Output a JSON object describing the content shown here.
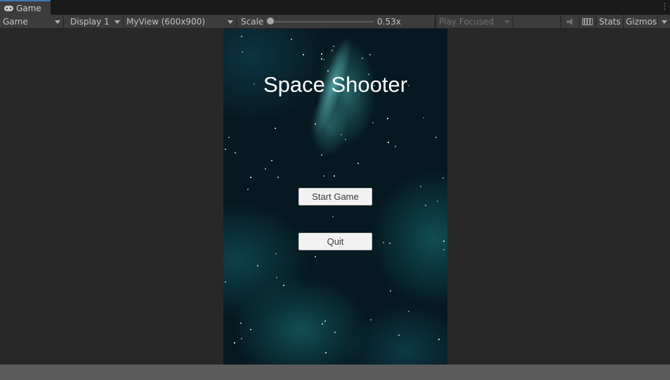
{
  "tab": {
    "label": "Game",
    "icon": "gamepad-icon"
  },
  "toolbar": {
    "view_mode": "Game",
    "display": "Display 1",
    "resolution": "MyView (600x900)",
    "scale_label": "Scale",
    "scale_value": "0.53x",
    "scale_fraction": 0.0,
    "play_mode": "Play Focused",
    "stats_label": "Stats",
    "gizmos_label": "Gizmos"
  },
  "game": {
    "title": "Space Shooter",
    "start_button": "Start Game",
    "quit_button": "Quit"
  },
  "colors": {
    "editor_background": "#282828",
    "toolbar": "#3c3c3c",
    "tab_accent": "#3a79bb",
    "button": "#f2f2f2"
  }
}
